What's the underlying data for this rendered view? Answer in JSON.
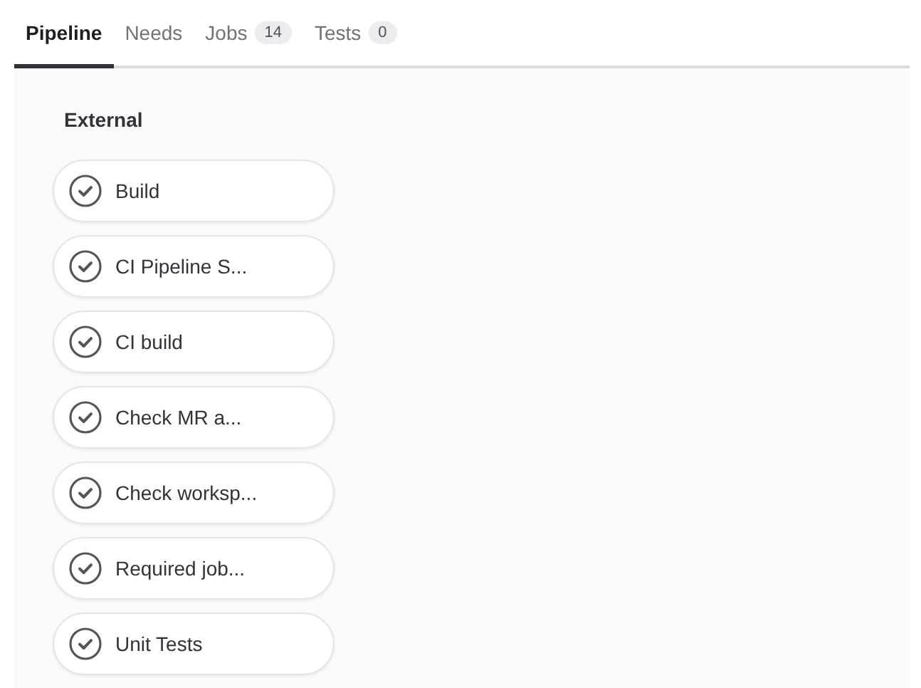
{
  "tabs": [
    {
      "label": "Pipeline",
      "selected": true
    },
    {
      "label": "Needs",
      "selected": false
    },
    {
      "label": "Jobs",
      "count": "14",
      "selected": false
    },
    {
      "label": "Tests",
      "count": "0",
      "selected": false
    }
  ],
  "stage": {
    "title": "External",
    "jobs": [
      {
        "name": "Build",
        "kind": "success"
      },
      {
        "name": "CI Pipeline S...",
        "kind": "success"
      },
      {
        "name": "CI build",
        "kind": "success"
      },
      {
        "name": "Check MR a...",
        "kind": "success"
      },
      {
        "name": "Check worksp...",
        "kind": "success"
      },
      {
        "name": "Required job...",
        "kind": "success"
      },
      {
        "name": "Unit Tests",
        "kind": "success"
      }
    ]
  }
}
